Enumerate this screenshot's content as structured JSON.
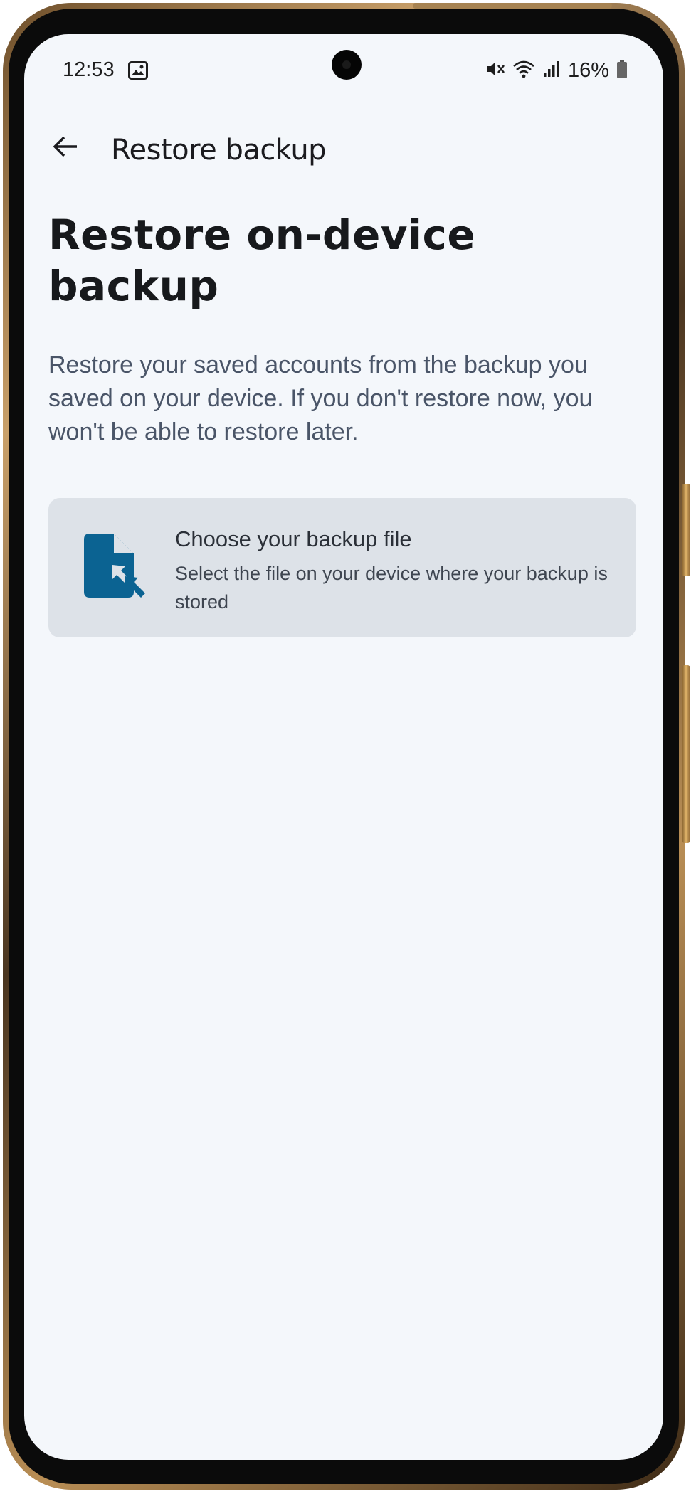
{
  "status_bar": {
    "time": "12:53",
    "battery_percent": "16%",
    "icons": [
      "image-icon",
      "mute-icon",
      "wifi-icon",
      "signal-icon",
      "battery-icon"
    ]
  },
  "app_bar": {
    "back_icon": "arrow-left-icon",
    "title": "Restore backup"
  },
  "main": {
    "heading_line1": "Restore on-device",
    "heading_line2": "backup",
    "description": "Restore your saved accounts from the backup you saved on your device. If you don't restore now, you won't be able to restore later.",
    "card": {
      "icon": "file-select-icon",
      "title": "Choose your backup file",
      "subtitle": "Select the file on your device where your backup is stored"
    }
  },
  "colors": {
    "screen_background": "#f4f7fb",
    "card_background": "#dde2e8",
    "accent": "#0b6392"
  }
}
